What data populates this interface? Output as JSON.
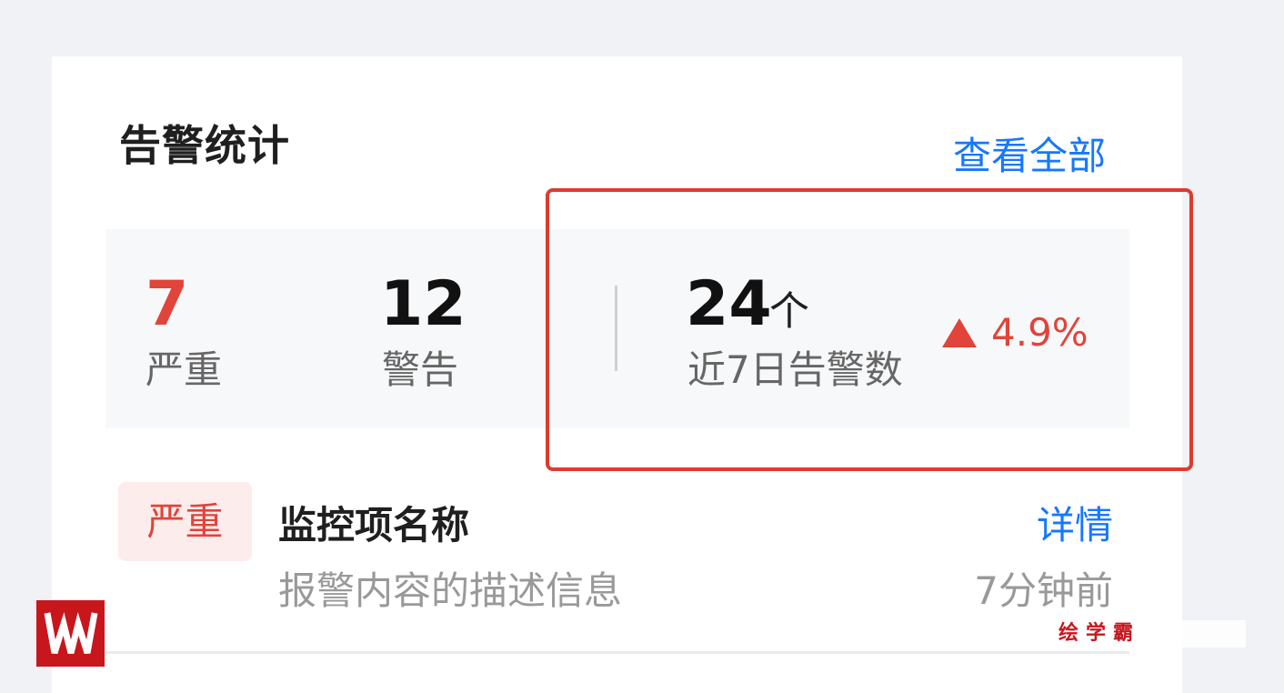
{
  "header": {
    "title": "告警统计",
    "view_all": "查看全部"
  },
  "stats": {
    "severe_count": "7",
    "severe_label": "严重",
    "warning_count": "12",
    "warning_label": "警告",
    "recent_count": "24",
    "recent_unit": "个",
    "recent_label": "近7日告警数",
    "trend_value": "4.9%",
    "trend_direction": "up",
    "trend_color": "#e0443a"
  },
  "alert": {
    "level_tag": "严重",
    "name": "监控项名称",
    "description": "报警内容的描述信息",
    "detail_link": "详情",
    "time": "7分钟前"
  },
  "watermark": {
    "brand": "绘学霸"
  },
  "colors": {
    "accent": "#1677ff",
    "danger": "#e0443a",
    "highlight_border": "#e03a2f"
  }
}
